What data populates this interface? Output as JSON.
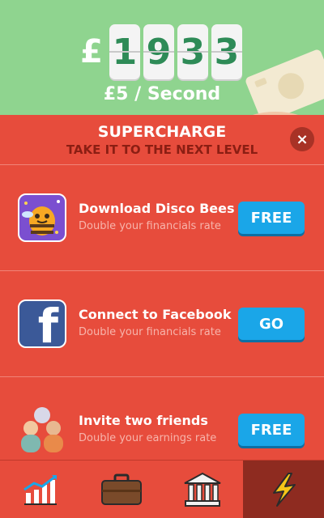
{
  "balance": {
    "currency": "£",
    "digits": [
      "1",
      "9",
      "3",
      "3"
    ],
    "rate": "£5 / Second"
  },
  "panel": {
    "title": "SUPERCHARGE",
    "subtitle": "TAKE IT TO THE NEXT LEVEL",
    "close_label": "×"
  },
  "offers": [
    {
      "title": "Download Disco Bees",
      "desc": "Double your financials rate",
      "button": "FREE",
      "icon": "disco-bees-app-icon"
    },
    {
      "title": "Connect to Facebook",
      "desc": "Double your financials rate",
      "button": "GO",
      "icon": "facebook-icon",
      "icon_glyph": "f"
    },
    {
      "title": "Invite two friends",
      "desc": "Double your earnings rate",
      "button": "FREE",
      "icon": "friends-icon"
    }
  ],
  "nav": [
    {
      "icon": "chart-icon",
      "active": false
    },
    {
      "icon": "briefcase-icon",
      "active": false
    },
    {
      "icon": "bank-icon",
      "active": false
    },
    {
      "icon": "lightning-icon",
      "active": true
    }
  ],
  "colors": {
    "top_bg": "#8fd48f",
    "panel_bg": "#e74c3c",
    "button": "#1aa6e8",
    "digit_text": "#2e8b57",
    "subtitle": "#8b1e13"
  }
}
